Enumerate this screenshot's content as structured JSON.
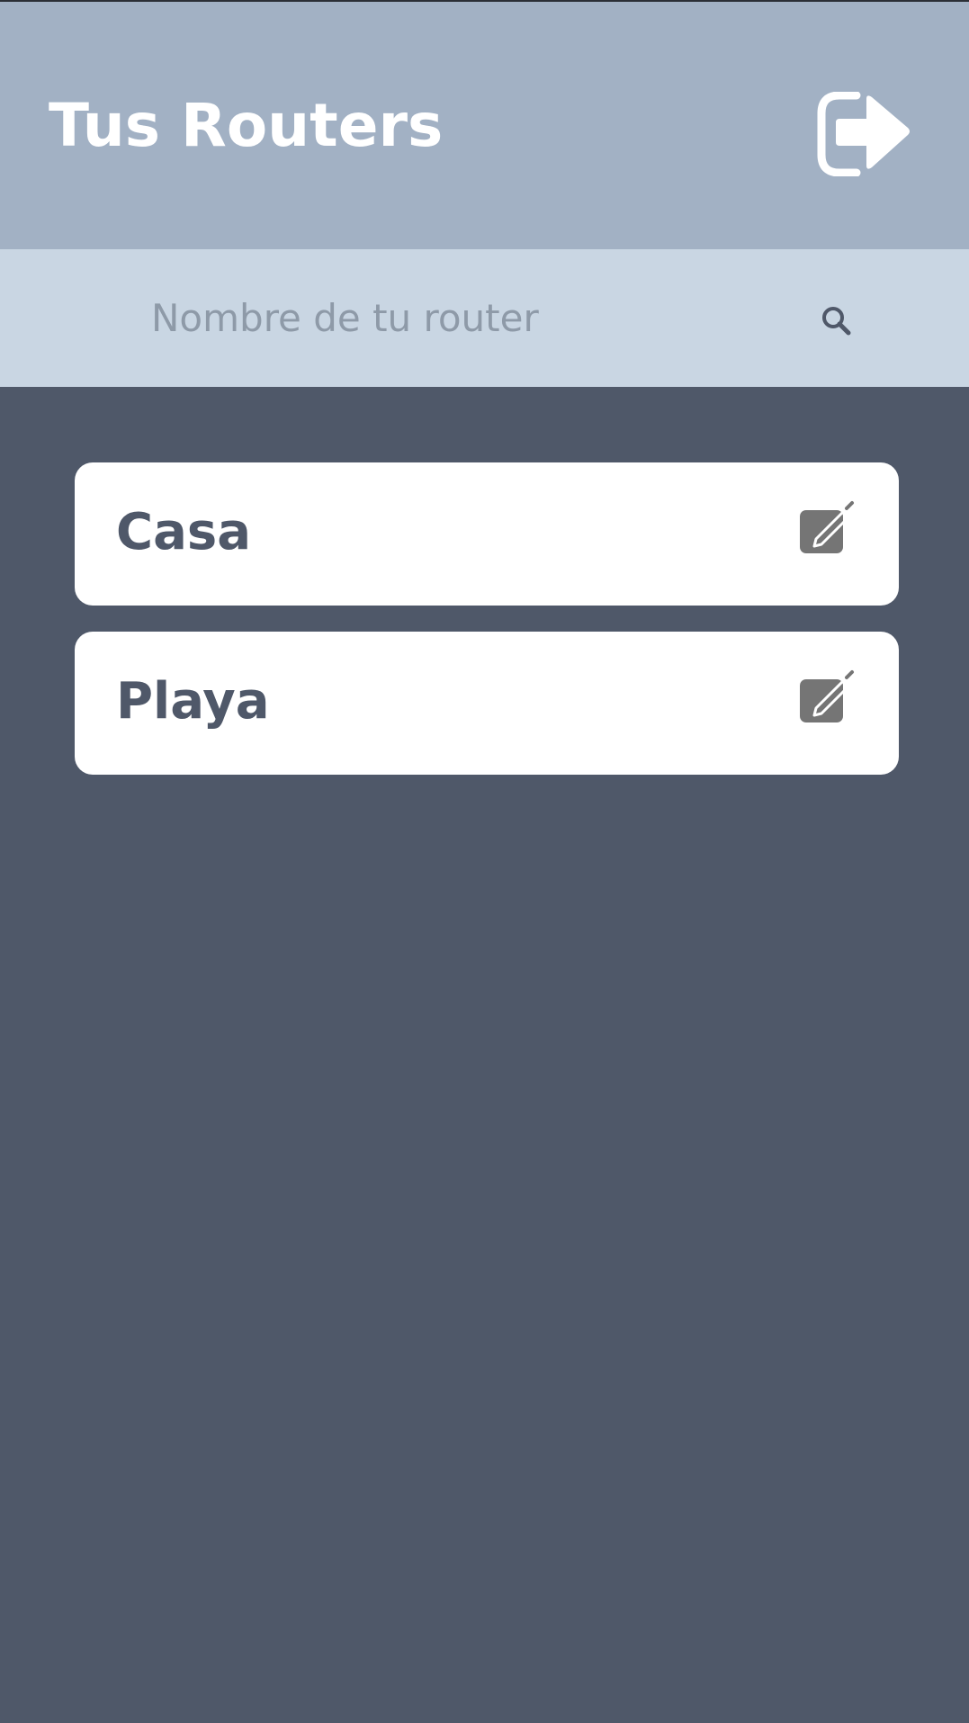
{
  "header": {
    "title": "Tus Routers",
    "logout_icon": "logout-icon"
  },
  "search": {
    "placeholder": "Nombre de tu router",
    "value": "",
    "icon": "search-icon"
  },
  "routers": [
    {
      "name": "Casa",
      "edit_icon": "edit-icon"
    },
    {
      "name": "Playa",
      "edit_icon": "edit-icon"
    }
  ],
  "colors": {
    "header_bg": "#a2b1c4",
    "search_bg": "#c9d6e3",
    "page_bg": "#4f5869",
    "card_bg": "#ffffff",
    "text_dark": "#4f5869",
    "icon_gray": "#757575"
  }
}
